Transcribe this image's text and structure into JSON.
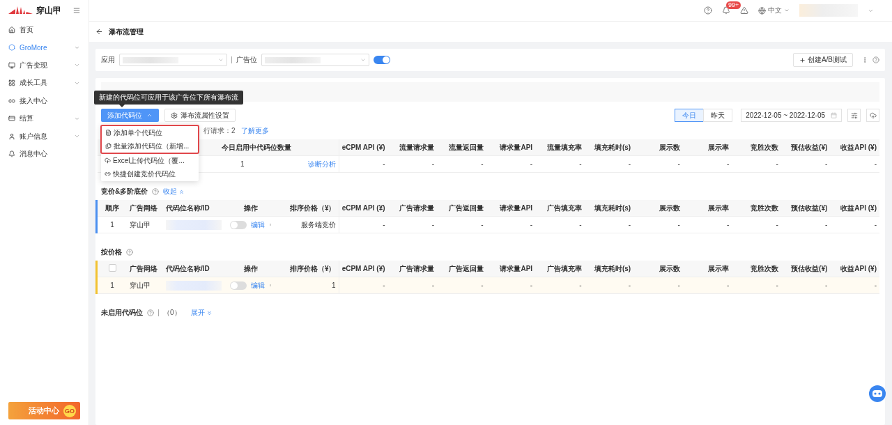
{
  "sidebar": {
    "brand": "穿山甲",
    "items": [
      {
        "label": "首页",
        "selected": false,
        "expandable": false
      },
      {
        "label": "GroMore",
        "selected": true,
        "expandable": true
      },
      {
        "label": "广告变现",
        "selected": false,
        "expandable": true
      },
      {
        "label": "成长工具",
        "selected": false,
        "expandable": true
      },
      {
        "label": "接入中心",
        "selected": false,
        "expandable": false
      },
      {
        "label": "结算",
        "selected": false,
        "expandable": true
      },
      {
        "label": "账户信息",
        "selected": false,
        "expandable": true
      },
      {
        "label": "消息中心",
        "selected": false,
        "expandable": false
      }
    ],
    "promo": {
      "label": "活动中心",
      "badge": "GO"
    }
  },
  "header": {
    "notification_badge": "99+",
    "language": "中文"
  },
  "page": {
    "title": "瀑布流管理"
  },
  "filters": {
    "app_label": "应用",
    "slot_label": "广告位",
    "slot_enabled": true,
    "ab_button": "创建A/B测试"
  },
  "toolbar": {
    "add_button": "添加代码位",
    "add_expanded": true,
    "settings_button": "瀑布流属性设置",
    "date_tabs": [
      {
        "label": "今日",
        "selected": true
      },
      {
        "label": "昨天",
        "selected": false
      }
    ],
    "date_range": "2022-12-05 ~ 2022-12-05"
  },
  "tooltip": "新建的代码位可应用于该广告位下所有瀑布流",
  "add_menu": [
    {
      "label": "添加单个代码位",
      "kind": "file",
      "highlighted": true
    },
    {
      "label": "批量添加代码位（新增...",
      "kind": "files",
      "highlighted": true
    },
    {
      "label": "Excel上传代码位（覆...",
      "kind": "upload",
      "highlighted": false
    },
    {
      "label": "快捷创建竞价代码位",
      "kind": "link",
      "highlighted": false
    }
  ],
  "request_note": {
    "text": "行请求：2",
    "link": "了解更多"
  },
  "summary_table": {
    "columns": [
      "",
      "今日启用中代码位数量",
      "eCPM API (¥)",
      "流量请求量",
      "流量返回量",
      "请求量API",
      "流量填充率",
      "填充耗时(s)",
      "展示数",
      "展示率",
      "竞胜次数",
      "预估收益(¥)",
      "收益API (¥)"
    ],
    "rows": [
      {
        "count": "1",
        "link": "诊断分析",
        "values": [
          "-",
          "-",
          "-",
          "-",
          "-",
          "-",
          "-",
          "-",
          "-",
          "-",
          "-"
        ]
      }
    ]
  },
  "sections": [
    {
      "title": "竞价&多阶底价",
      "toggle": "收起",
      "expanded": true,
      "color": "#4a8ff0",
      "columns": [
        {
          "kind": "text",
          "label": "顺序"
        },
        {
          "kind": "text",
          "label": "广告网络"
        },
        {
          "kind": "text",
          "label": "代码位名称/ID"
        },
        {
          "kind": "text",
          "label": "操作"
        },
        {
          "kind": "text",
          "label": "排序价格（¥）"
        },
        {
          "kind": "text",
          "label": "eCPM API (¥)"
        },
        {
          "kind": "text",
          "label": "广告请求量"
        },
        {
          "kind": "text",
          "label": "广告返回量"
        },
        {
          "kind": "text",
          "label": "请求量API"
        },
        {
          "kind": "text",
          "label": "广告填充率"
        },
        {
          "kind": "text",
          "label": "填充耗时(s)"
        },
        {
          "kind": "text",
          "label": "展示数"
        },
        {
          "kind": "text",
          "label": "展示率"
        },
        {
          "kind": "text",
          "label": "竞胜次数"
        },
        {
          "kind": "text",
          "label": "预估收益(¥)"
        },
        {
          "kind": "text",
          "label": "收益API (¥)"
        }
      ],
      "rows": [
        {
          "highlighted": false,
          "order": "1",
          "network": "穿山甲",
          "enabled": false,
          "edit": "编辑",
          "price": "服务端竞价",
          "values": [
            "-",
            "-",
            "-",
            "-",
            "-",
            "-",
            "-",
            "-",
            "-",
            "-",
            "-"
          ]
        }
      ]
    },
    {
      "title": "按价格",
      "color": "#f2c230",
      "columns": [
        {
          "kind": "checkbox",
          "checked": false
        },
        {
          "kind": "text",
          "label": "广告网络"
        },
        {
          "kind": "text",
          "label": "代码位名称/ID"
        },
        {
          "kind": "text",
          "label": "操作"
        },
        {
          "kind": "text",
          "label": "排序价格（¥）"
        },
        {
          "kind": "text",
          "label": "eCPM API (¥)"
        },
        {
          "kind": "text",
          "label": "广告请求量"
        },
        {
          "kind": "text",
          "label": "广告返回量"
        },
        {
          "kind": "text",
          "label": "请求量API"
        },
        {
          "kind": "text",
          "label": "广告填充率"
        },
        {
          "kind": "text",
          "label": "填充耗时(s)"
        },
        {
          "kind": "text",
          "label": "展示数"
        },
        {
          "kind": "text",
          "label": "展示率"
        },
        {
          "kind": "text",
          "label": "竞胜次数"
        },
        {
          "kind": "text",
          "label": "预估收益(¥)"
        },
        {
          "kind": "text",
          "label": "收益API (¥)"
        }
      ],
      "rows": [
        {
          "highlighted": true,
          "order": "1",
          "network": "穿山甲",
          "enabled": false,
          "edit": "编辑",
          "price": "1",
          "values": [
            "-",
            "-",
            "-",
            "-",
            "-",
            "-",
            "-",
            "-",
            "-",
            "-",
            "-"
          ]
        }
      ]
    }
  ],
  "inactive": {
    "title": "未启用代码位",
    "count": "（0）",
    "toggle": "展开",
    "expanded": false
  }
}
